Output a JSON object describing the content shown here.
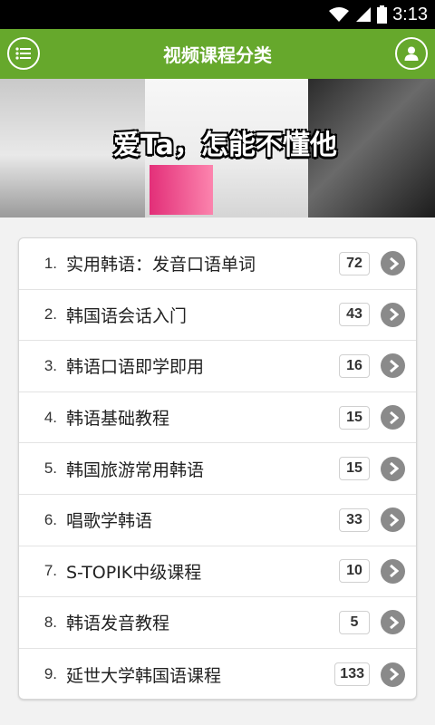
{
  "status_bar": {
    "time": "3:13",
    "icons": [
      "wifi-icon",
      "signal-icon",
      "battery-icon"
    ]
  },
  "app_bar": {
    "title": "视频课程分类",
    "left_icon": "menu-list-icon",
    "right_icon": "user-icon",
    "color": "#66a82c"
  },
  "banner": {
    "caption": "爱Ta，怎能不懂他"
  },
  "courses": [
    {
      "num": "1.",
      "title": "实用韩语：发音口语单词",
      "count": "72"
    },
    {
      "num": "2.",
      "title": "韩国语会话入门",
      "count": "43"
    },
    {
      "num": "3.",
      "title": "韩语口语即学即用",
      "count": "16"
    },
    {
      "num": "4.",
      "title": "韩语基础教程",
      "count": "15"
    },
    {
      "num": "5.",
      "title": "韩国旅游常用韩语",
      "count": "15"
    },
    {
      "num": "6.",
      "title": "唱歌学韩语",
      "count": "33"
    },
    {
      "num": "7.",
      "title": "S-TOPIK中级课程",
      "count": "10"
    },
    {
      "num": "8.",
      "title": "韩语发音教程",
      "count": "5"
    },
    {
      "num": "9.",
      "title": "延世大学韩国语课程",
      "count": "133"
    }
  ]
}
